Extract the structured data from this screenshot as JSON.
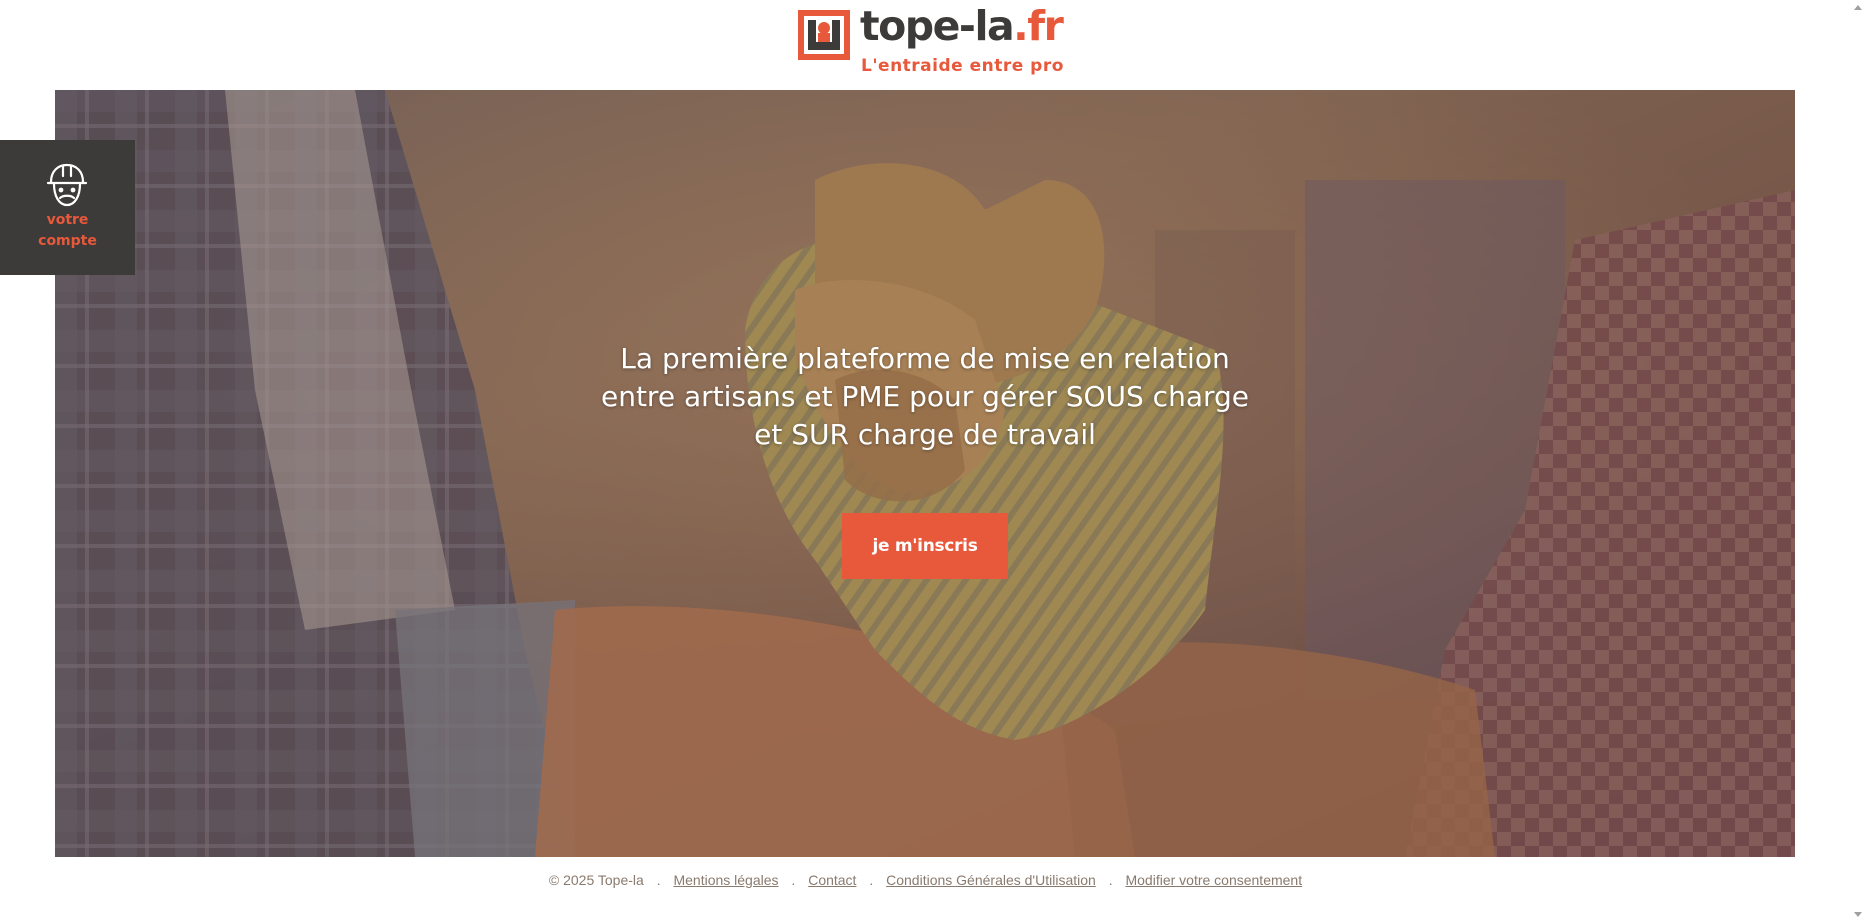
{
  "brand": {
    "name_main": "tope-la",
    "name_tld": ".fr",
    "tagline": "L'entraide entre pro",
    "colors": {
      "accent": "#e8583a",
      "dark": "#3d3b3a",
      "footer_text": "#8a7a6e"
    }
  },
  "account_tab": {
    "icon": "worker-helmet-icon",
    "label_line1": "votre",
    "label_line2": "compte"
  },
  "hero": {
    "headline": "La première plateforme de mise en relation entre artisans et PME pour gérer SOUS charge et SUR charge de travail",
    "cta_label": "je m'inscris",
    "background": "handshake-gloves-photo"
  },
  "footer": {
    "copyright": "© 2025 Tope-la",
    "separator": ".",
    "links": [
      "Mentions légales",
      "Contact",
      "Conditions Générales d'Utilisation",
      "Modifier votre consentement"
    ]
  }
}
